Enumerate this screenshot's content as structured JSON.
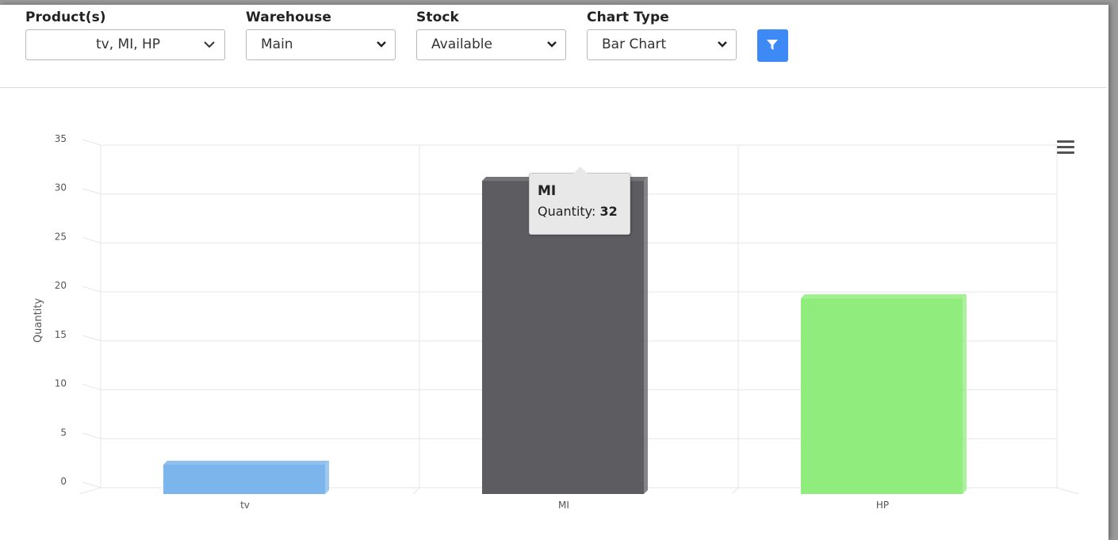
{
  "filters": {
    "products": {
      "label": "Product(s)",
      "value": "tv, MI, HP"
    },
    "warehouse": {
      "label": "Warehouse",
      "value": "Main"
    },
    "stock": {
      "label": "Stock",
      "value": "Available"
    },
    "chart_type": {
      "label": "Chart Type",
      "value": "Bar Chart"
    },
    "filter_icon": "filter-icon"
  },
  "tooltip": {
    "category": "MI",
    "series_label": "Quantity: ",
    "value": "32"
  },
  "menu_icon": "hamburger-menu-icon",
  "colors": {
    "accent": "#3d8af7",
    "tv": "#7cb5ec",
    "MI": "#5c5c61",
    "HP": "#90ed7d"
  },
  "chart_data": {
    "type": "bar",
    "categories": [
      "tv",
      "MI",
      "HP"
    ],
    "values": [
      3,
      32,
      20
    ],
    "ylabel": "Quantity",
    "xlabel": "",
    "ylim": [
      0,
      35
    ],
    "yticks": [
      0,
      5,
      10,
      15,
      20,
      25,
      30,
      35
    ],
    "grid": true,
    "legend": "none",
    "style": "3d"
  }
}
